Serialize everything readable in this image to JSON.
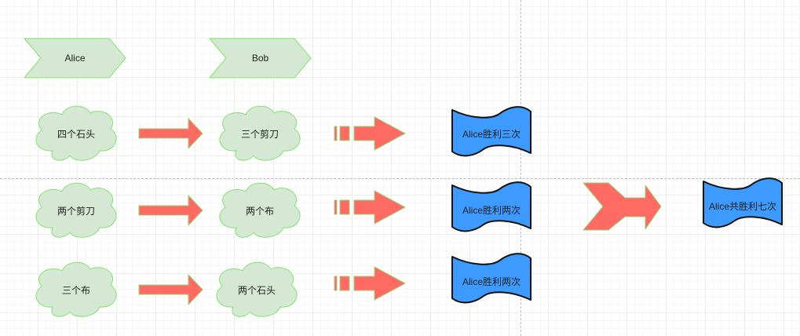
{
  "players": [
    {
      "name": "Alice"
    },
    {
      "name": "Bob"
    }
  ],
  "rounds": [
    {
      "alice": "四个石头",
      "bob": "三个剪刀",
      "result": "Alice胜利三次"
    },
    {
      "alice": "两个剪刀",
      "bob": "两个布",
      "result": "Alice胜利两次"
    },
    {
      "alice": "三个布",
      "bob": "两个石头",
      "result": "Alice胜利两次"
    }
  ],
  "total": "Alice共胜利七次",
  "colors": {
    "player_fill": "#d5e8d4",
    "player_stroke": "#82e36d",
    "arrow_fill": "#ff6b63",
    "arrow_stroke": "#97d077",
    "result_fill": "#3d9bff",
    "result_stroke": "#111111"
  }
}
